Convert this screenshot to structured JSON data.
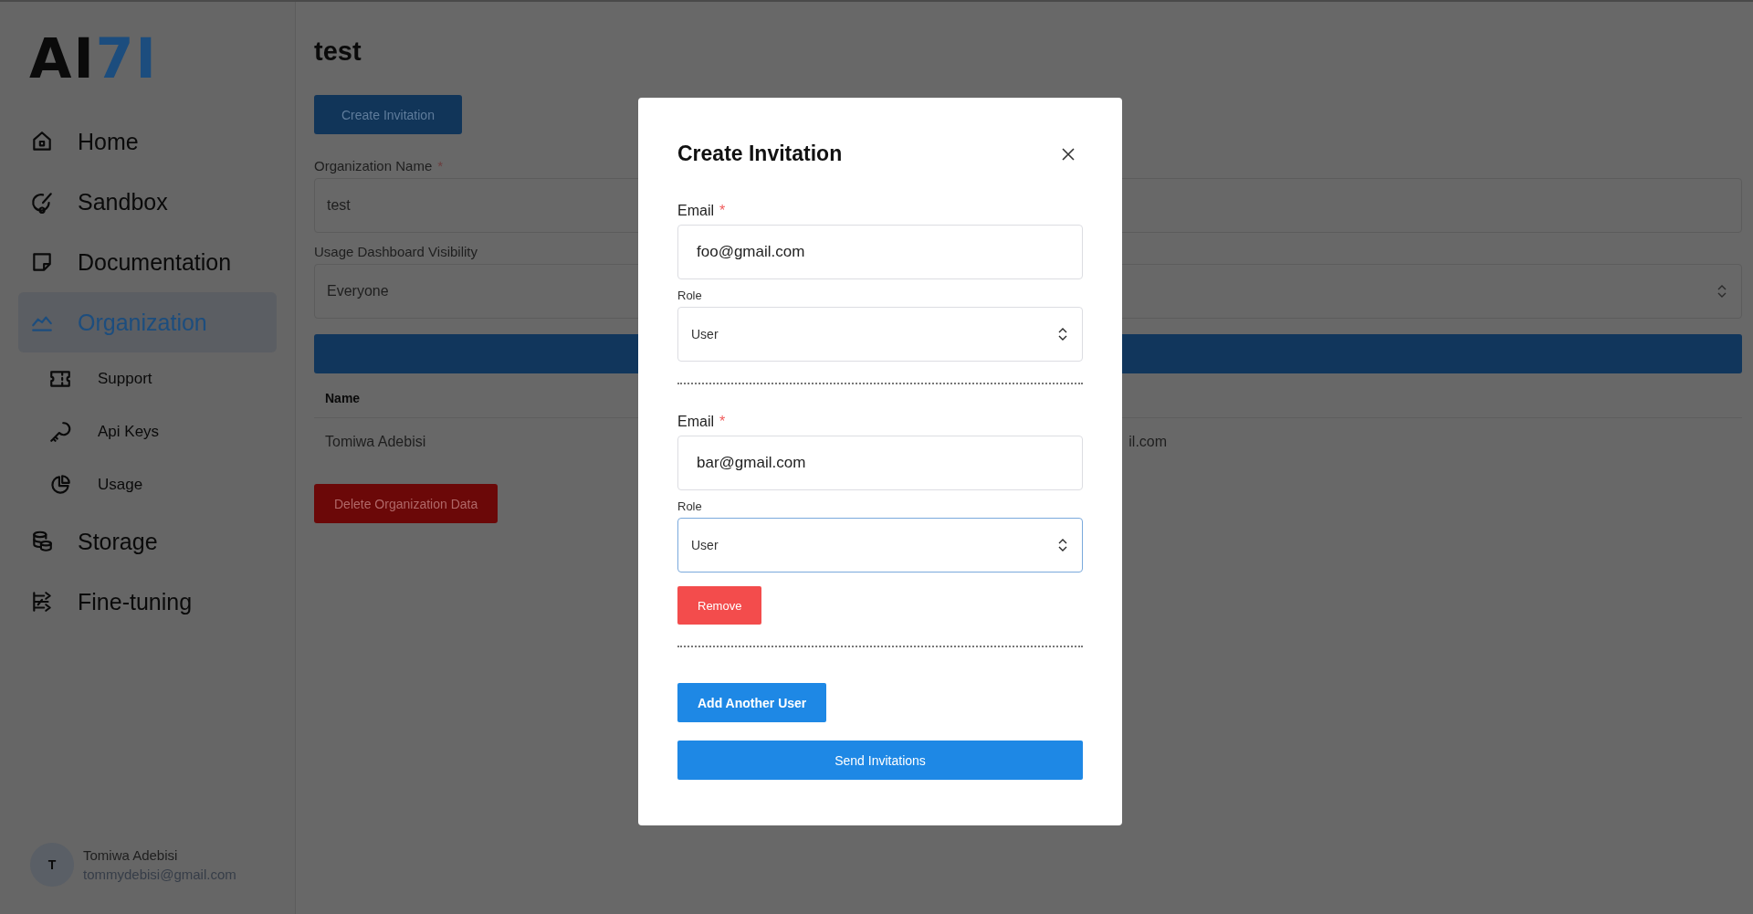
{
  "logo": {
    "text": "AI",
    "accent": "7I"
  },
  "nav": [
    {
      "label": "Home",
      "selected": false
    },
    {
      "label": "Sandbox",
      "selected": false
    },
    {
      "label": "Documentation",
      "selected": false
    },
    {
      "label": "Organization",
      "selected": true,
      "children": [
        {
          "label": "Support",
          "selected": false
        },
        {
          "label": "Api Keys",
          "selected": false
        },
        {
          "label": "Usage",
          "selected": false
        }
      ]
    },
    {
      "label": "Storage",
      "selected": false
    },
    {
      "label": "Fine-tuning",
      "selected": false
    }
  ],
  "user": {
    "initial": "T",
    "name": "Tomiwa Adebisi",
    "email": "tommydebisi@gmail.com"
  },
  "page": {
    "title": "test",
    "create_button": "Create Invitation",
    "org_name": {
      "label": "Organization Name",
      "required_mark": "*",
      "value": "test"
    },
    "visibility": {
      "label": "Usage Dashboard Visibility",
      "value": "Everyone"
    },
    "table": {
      "columns": [
        "Name"
      ],
      "rows": [
        {
          "name": "Tomiwa Adebisi",
          "email": "il.com"
        }
      ]
    },
    "delete_button": "Delete Organization Data"
  },
  "modal": {
    "title": "Create Invitation",
    "invitees": [
      {
        "email_label": "Email",
        "required_mark": "*",
        "email": "foo@gmail.com",
        "role_label": "Role",
        "role": "User",
        "focused": false
      },
      {
        "email_label": "Email",
        "required_mark": "*",
        "email": "bar@gmail.com",
        "role_label": "Role",
        "role": "User",
        "focused": true,
        "remove_button": "Remove"
      }
    ],
    "add_button": "Add Another User",
    "send_button": "Send Invitations"
  }
}
